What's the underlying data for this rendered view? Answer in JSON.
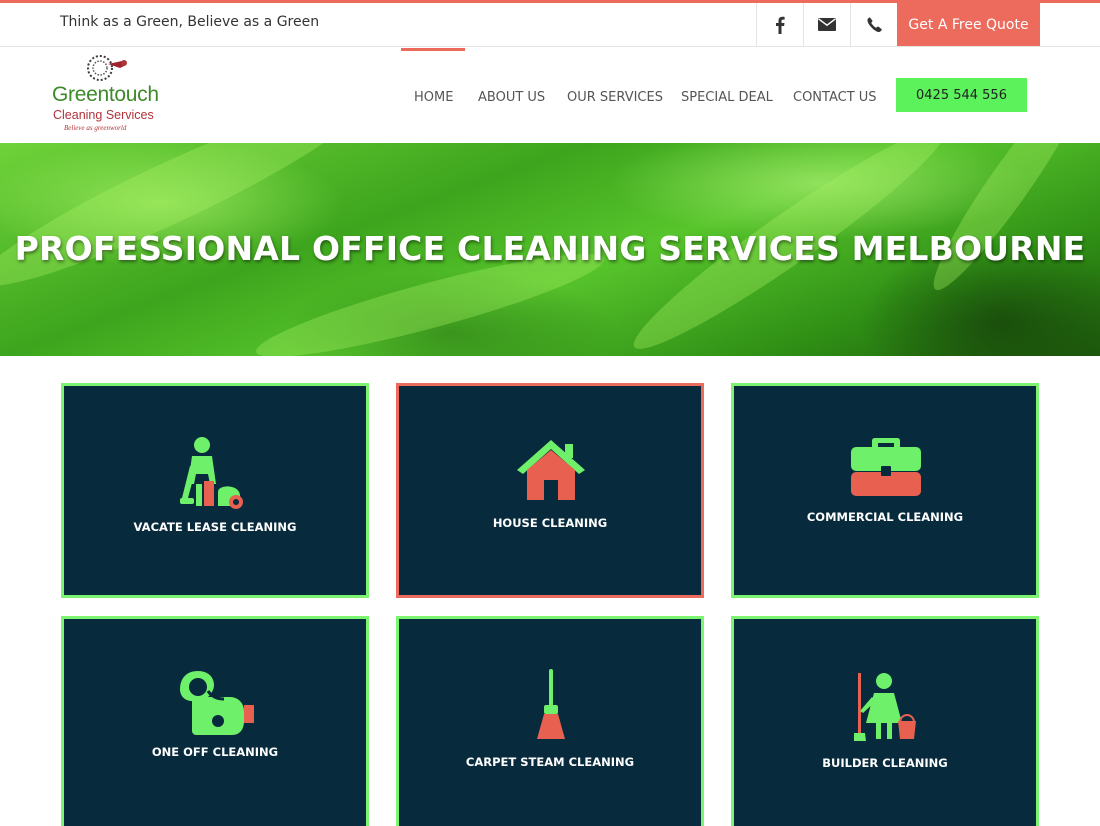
{
  "topbar": {
    "tagline": "Think as a Green, Believe as a Green",
    "icons": [
      "facebook-icon",
      "envelope-icon",
      "phone-icon"
    ],
    "quote_label": "Get A Free Quote"
  },
  "logo": {
    "name": "Greentouch",
    "subtitle": "Cleaning Services",
    "slogan": "Believe as greenworld"
  },
  "nav": {
    "items": [
      "HOME",
      "ABOUT US",
      "OUR SERVICES",
      "SPECIAL DEAL",
      "CONTACT US"
    ],
    "active": "HOME",
    "phone": "0425 544 556"
  },
  "hero": {
    "title": "PROFESSIONAL OFFICE CLEANING SERVICES MELBOURNE"
  },
  "services": [
    {
      "label": "VACATE LEASE CLEANING",
      "icon": "person-vacuum-icon"
    },
    {
      "label": "HOUSE CLEANING",
      "icon": "house-icon"
    },
    {
      "label": "COMMERCIAL CLEANING",
      "icon": "briefcase-icon"
    },
    {
      "label": "ONE OFF CLEANING",
      "icon": "vacuum-icon"
    },
    {
      "label": "CARPET STEAM CLEANING",
      "icon": "broom-icon"
    },
    {
      "label": "BUILDER CLEANING",
      "icon": "cleaner-mop-icon"
    }
  ],
  "colors": {
    "accent": "#ec6b5c",
    "green": "#5cf25c",
    "card_bg": "#072a3c",
    "card_border": "#7cf472",
    "icon_green": "#6ef06a",
    "icon_red": "#e8604f"
  }
}
